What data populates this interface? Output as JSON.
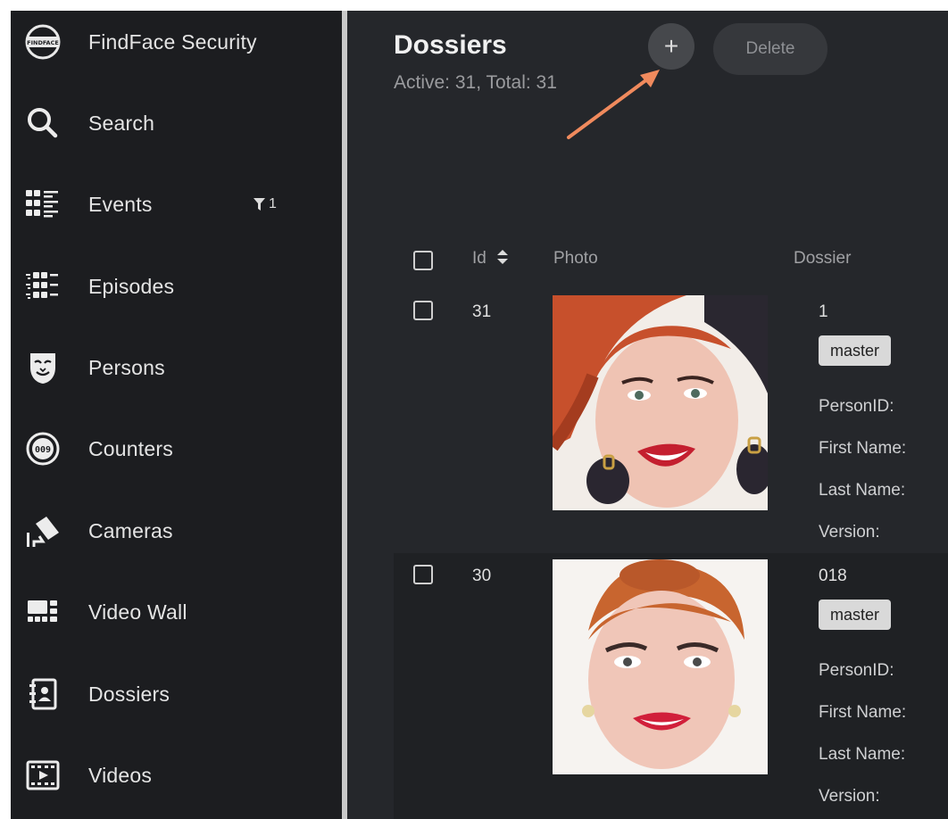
{
  "app": {
    "title": "FindFace Security"
  },
  "sidebar": {
    "items": [
      {
        "label": "FindFace Security",
        "icon": "findface-logo-icon"
      },
      {
        "label": "Search",
        "icon": "search-icon"
      },
      {
        "label": "Events",
        "icon": "events-grid-icon",
        "badge": "1"
      },
      {
        "label": "Episodes",
        "icon": "episodes-grid-icon"
      },
      {
        "label": "Persons",
        "icon": "mask-icon"
      },
      {
        "label": "Counters",
        "icon": "counter-icon"
      },
      {
        "label": "Cameras",
        "icon": "camera-icon"
      },
      {
        "label": "Video Wall",
        "icon": "video-wall-icon"
      },
      {
        "label": "Dossiers",
        "icon": "dossier-icon"
      },
      {
        "label": "Videos",
        "icon": "film-icon"
      }
    ]
  },
  "header": {
    "title": "Dossiers",
    "subtitle": "Active: 31, Total: 31",
    "add_label": "+",
    "delete_label": "Delete"
  },
  "table": {
    "columns": [
      "Id",
      "Photo",
      "Dossier"
    ],
    "rows": [
      {
        "id": "31",
        "name": "1",
        "tag": "master",
        "fields": [
          "PersonID:",
          "First Name:",
          "Last Name:",
          "Version:"
        ]
      },
      {
        "id": "30",
        "name": "018",
        "tag": "master",
        "fields": [
          "PersonID:",
          "First Name:",
          "Last Name:",
          "Version:"
        ]
      }
    ]
  },
  "colors": {
    "sidebar_bg": "#1c1d20",
    "main_bg": "#25272b",
    "arrow": "#f08a5d",
    "tag_bg": "#d9d9d9"
  }
}
